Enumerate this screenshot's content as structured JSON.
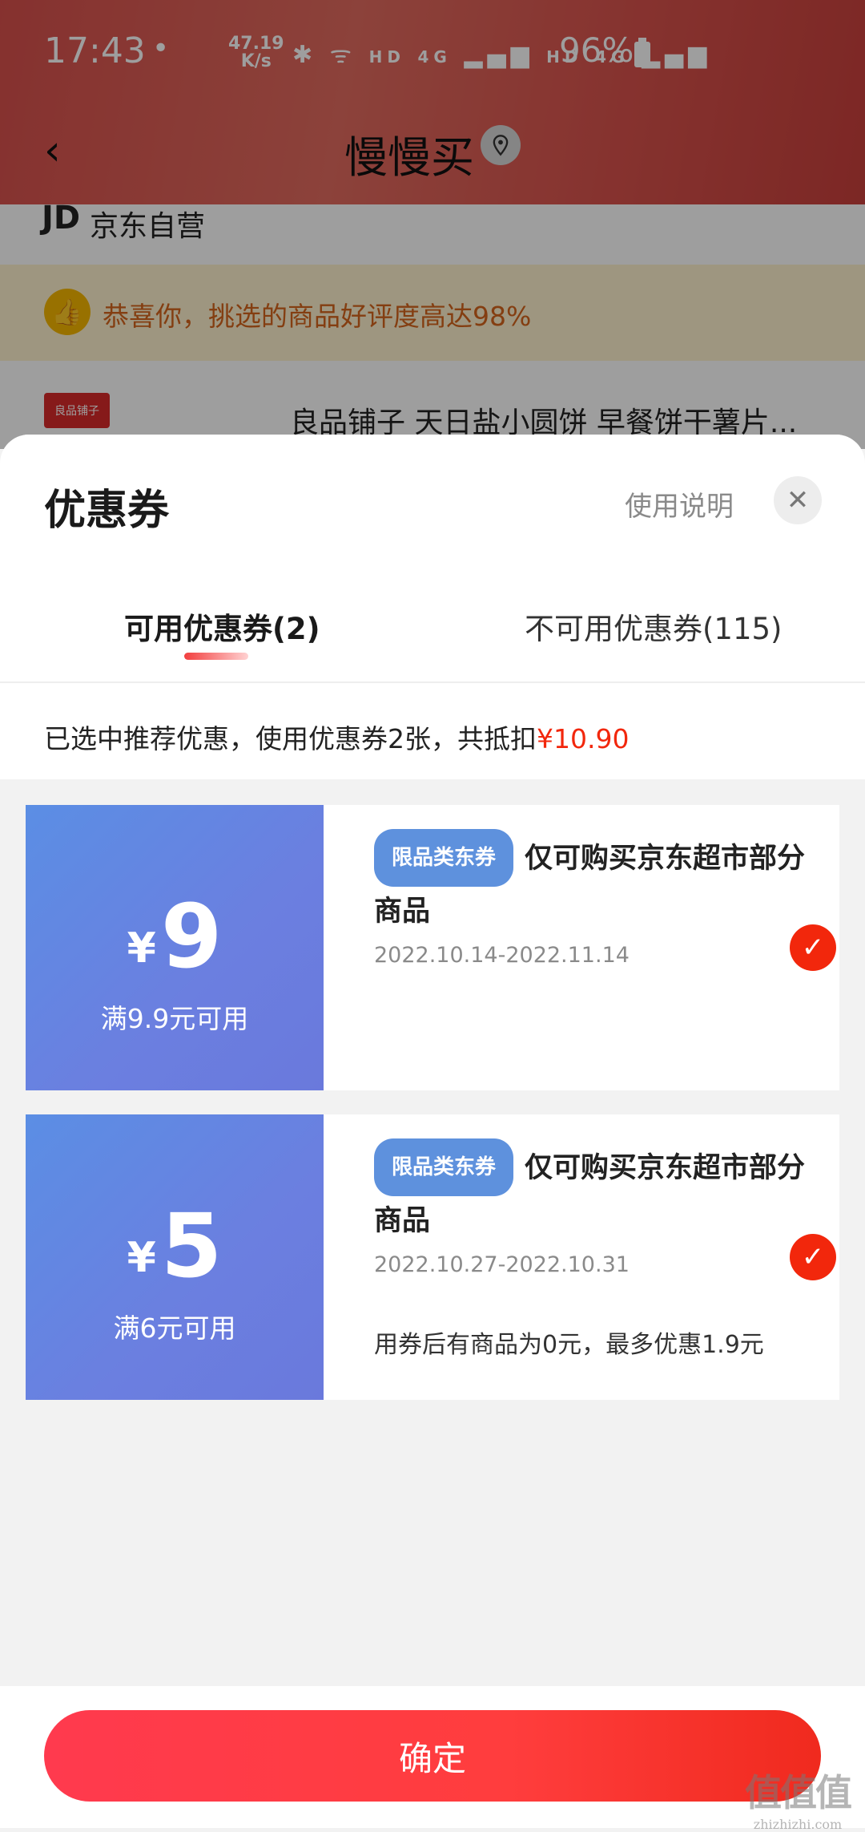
{
  "status_bar": {
    "time": "17:43",
    "dot": "•",
    "speed_value": "47.19",
    "speed_unit": "K/s",
    "icons": "✱ ᯤ",
    "hd1": "HD",
    "net1": "4G",
    "hd2": "HD",
    "net2": "4G",
    "battery": "96%"
  },
  "nav": {
    "back": "‹",
    "title": "慢慢买"
  },
  "background": {
    "jd_logo": "JD",
    "seller": "京东自营",
    "banner_text": "恭喜你，挑选的商品好评度高达98%",
    "shop_logo": "良品铺子",
    "product_title": "良品铺子 天日盐小圆饼 早餐饼干薯片..."
  },
  "sheet": {
    "title": "优惠券",
    "help": "使用说明",
    "close": "✕",
    "tabs": [
      {
        "label": "可用优惠券(2)"
      },
      {
        "label": "不可用优惠券(115)"
      }
    ],
    "summary_prefix": "已选中推荐优惠，使用优惠券2张，共抵扣",
    "summary_amount": "¥10.90"
  },
  "coupons": [
    {
      "currency": "¥",
      "amount": "9",
      "condition": "满9.9元可用",
      "tag": "限品类东券",
      "desc": "仅可购买京东超市部分商品",
      "date": "2022.10.14-2022.11.14",
      "note": "",
      "checked": "✓"
    },
    {
      "currency": "¥",
      "amount": "5",
      "condition": "满6元可用",
      "tag": "限品类东券",
      "desc": "仅可购买京东超市部分商品",
      "date": "2022.10.27-2022.10.31",
      "note": "用券后有商品为0元，最多优惠1.9元",
      "checked": "✓"
    }
  ],
  "footer": {
    "confirm": "确定"
  },
  "watermark": {
    "main": "值值值",
    "sub": "zhizhizhi.com"
  },
  "colors": {
    "accent_red": "#f2270c",
    "coupon_blue": "#5e91dd"
  }
}
